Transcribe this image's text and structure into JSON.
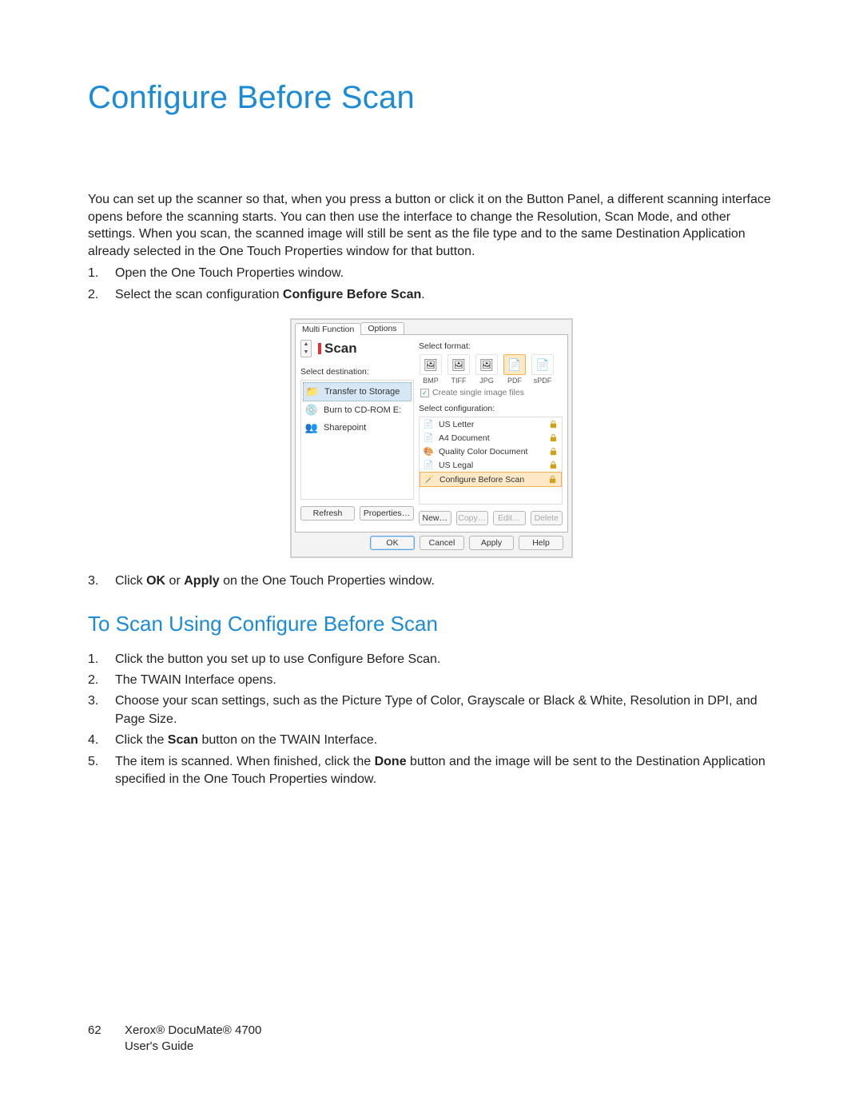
{
  "page": {
    "title": "Configure Before Scan",
    "intro": "You can set up the scanner so that, when you press a button or click it on the Button Panel, a different scanning interface opens before the scanning starts. You can then use the interface to change the Resolution, Scan Mode, and other settings. When you scan, the scanned image will still be sent as the file type and to the same Destination Application already selected in the One Touch Properties window for that button.",
    "steps_a": [
      "Open the One Touch Properties window.",
      "Select the scan configuration "
    ],
    "steps_a_bold": "Configure Before Scan",
    "steps_a_tail": ".",
    "step3_pre": "Click ",
    "step3_b1": "OK",
    "step3_mid": " or ",
    "step3_b2": "Apply",
    "step3_post": " on the One Touch Properties window.",
    "h2": "To Scan Using Configure Before Scan",
    "steps_b": [
      "Click the button you set up to use Configure Before Scan.",
      "The TWAIN Interface opens.",
      "Choose your scan settings, such as the Picture Type of Color, Grayscale or Black & White, Resolution in DPI, and Page Size.",
      "",
      ""
    ],
    "s4_pre": "Click the ",
    "s4_b": "Scan",
    "s4_post": " button on the TWAIN Interface.",
    "s5_pre": "The item is scanned. When finished, click the ",
    "s5_b": "Done",
    "s5_post": " button and the image will be sent to the Destination Application specified in the One Touch Properties window.",
    "footer_page": "62",
    "footer_l1": "Xerox® DocuMate® 4700",
    "footer_l2": "User's Guide"
  },
  "dlg": {
    "tabs": [
      "Multi Function",
      "Options"
    ],
    "scan_label": "Scan",
    "sel_dest": "Select destination:",
    "dests": [
      {
        "icon": "📁",
        "label": "Transfer to Storage",
        "sel": true
      },
      {
        "icon": "💿",
        "label": "Burn to CD-ROM  E:"
      },
      {
        "icon": "👥",
        "label": "Sharepoint"
      }
    ],
    "sel_fmt": "Select format:",
    "fmts": [
      {
        "icon": "🖼",
        "label": "BMP"
      },
      {
        "icon": "🖼",
        "label": "TIFF"
      },
      {
        "icon": "🖼",
        "label": "JPG"
      },
      {
        "icon": "📄",
        "label": "PDF",
        "sel": true
      },
      {
        "icon": "📄",
        "label": "sPDF"
      }
    ],
    "chk": "Create single image files",
    "sel_cfg": "Select configuration:",
    "cfgs": [
      {
        "icon": "📄",
        "label": "US Letter"
      },
      {
        "icon": "📄",
        "label": "A4 Document"
      },
      {
        "icon": "🎨",
        "label": "Quality Color Document"
      },
      {
        "icon": "📄",
        "label": "US Legal"
      },
      {
        "icon": "🪄",
        "label": "Configure Before Scan",
        "sel": true
      }
    ],
    "btnsL": [
      "Refresh",
      "Properties…"
    ],
    "btnsR": [
      "New…",
      "Copy…",
      "Edit…",
      "Delete"
    ],
    "dlgbtns": [
      "OK",
      "Cancel",
      "Apply",
      "Help"
    ]
  }
}
